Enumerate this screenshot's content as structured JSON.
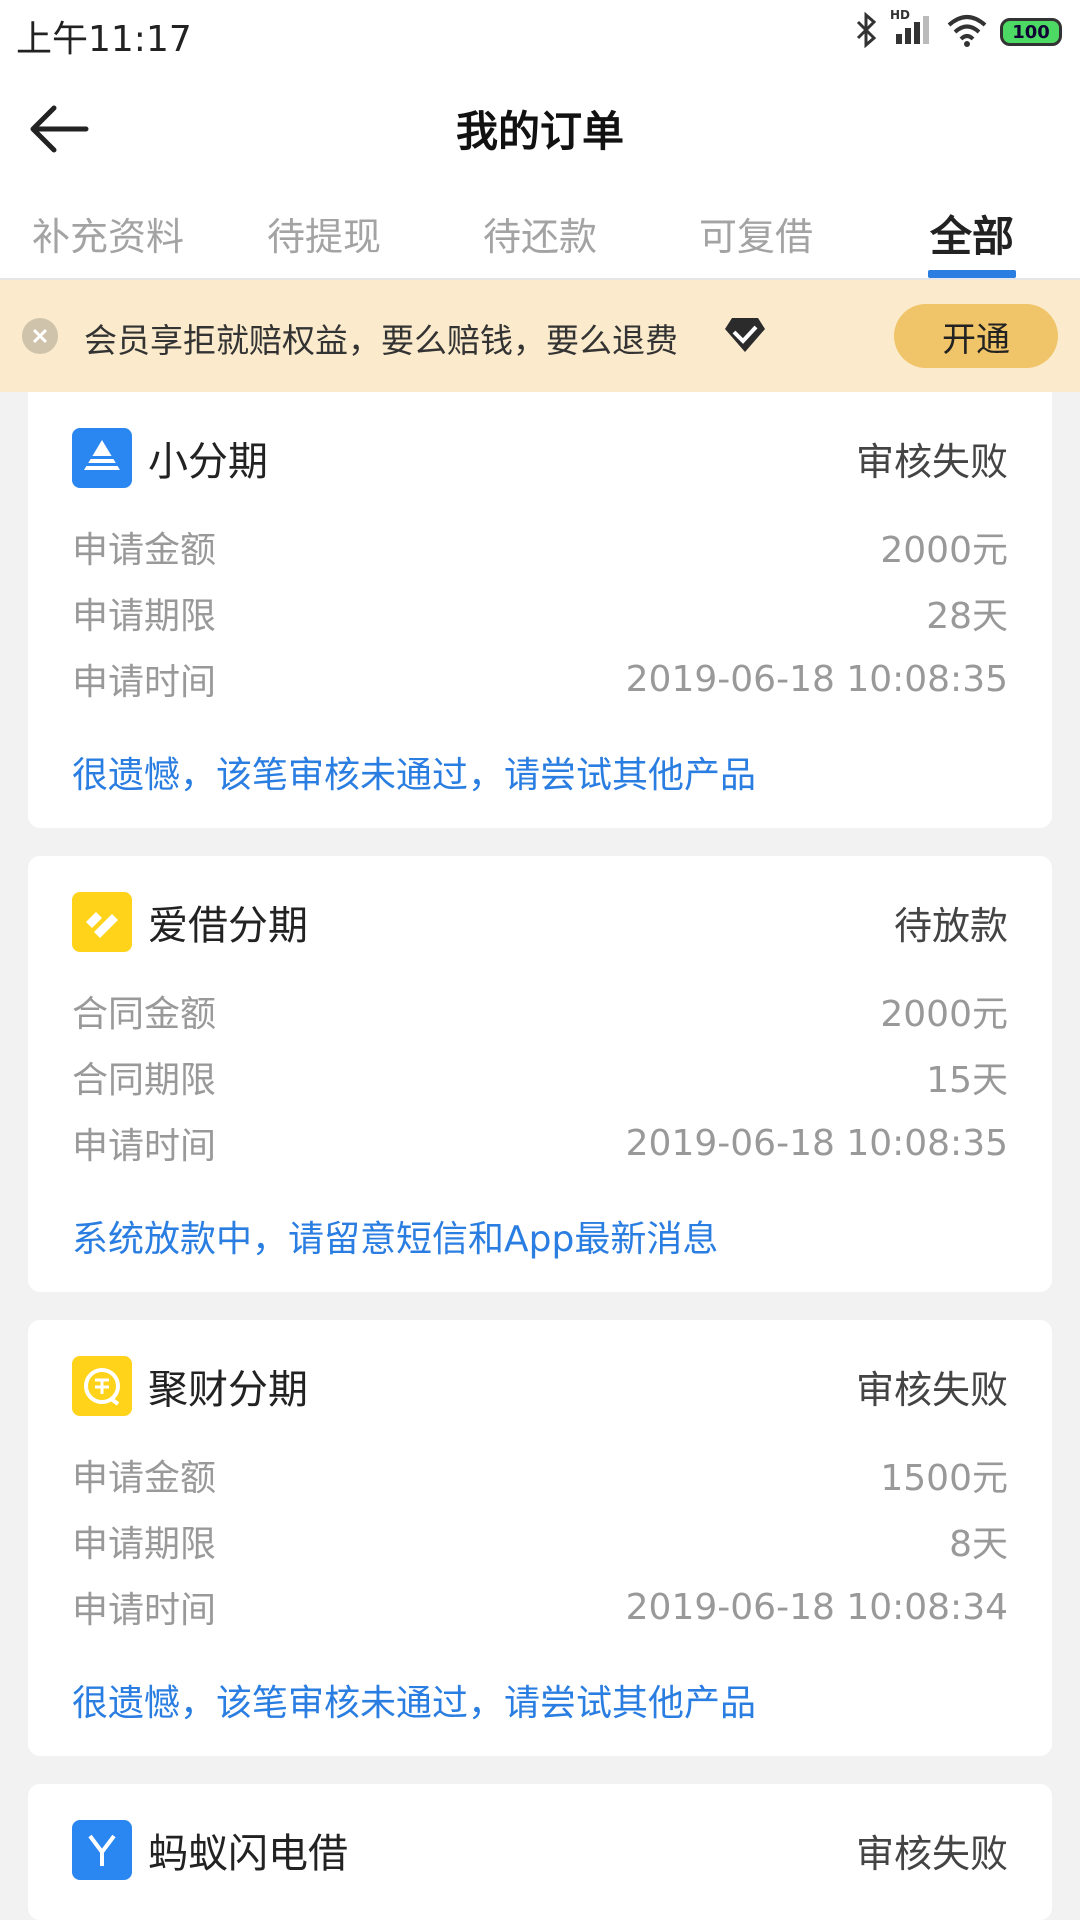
{
  "status_bar": {
    "time": "上午11:17",
    "battery": "100",
    "hd": "HD"
  },
  "header": {
    "title": "我的订单"
  },
  "tabs": [
    {
      "label": "补充资料"
    },
    {
      "label": "待提现"
    },
    {
      "label": "待还款"
    },
    {
      "label": "可复借"
    },
    {
      "label": "全部",
      "active": true
    }
  ],
  "banner": {
    "text": "会员享拒就赔权益，要么赔钱，要么退费",
    "button": "开通"
  },
  "orders": [
    {
      "name": "小分期",
      "status": "审核失败",
      "rows": [
        {
          "label": "申请金额",
          "value": "2000元"
        },
        {
          "label": "申请期限",
          "value": "28天"
        },
        {
          "label": "申请时间",
          "value": "2019-06-18 10:08:35"
        }
      ],
      "note": "很遗憾，该笔审核未通过，请尝试其他产品",
      "logo_color": "#2a86f0"
    },
    {
      "name": "爱借分期",
      "status": "待放款",
      "rows": [
        {
          "label": "合同金额",
          "value": "2000元"
        },
        {
          "label": "合同期限",
          "value": "15天"
        },
        {
          "label": "申请时间",
          "value": "2019-06-18 10:08:35"
        }
      ],
      "note": "系统放款中，请留意短信和App最新消息",
      "logo_color": "#ffd31a"
    },
    {
      "name": "聚财分期",
      "status": "审核失败",
      "rows": [
        {
          "label": "申请金额",
          "value": "1500元"
        },
        {
          "label": "申请期限",
          "value": "8天"
        },
        {
          "label": "申请时间",
          "value": "2019-06-18 10:08:34"
        }
      ],
      "note": "很遗憾，该笔审核未通过，请尝试其他产品",
      "logo_color": "#ffd31a"
    },
    {
      "name": "蚂蚁闪电借",
      "status": "审核失败",
      "logo_color": "#2a86f0"
    }
  ]
}
